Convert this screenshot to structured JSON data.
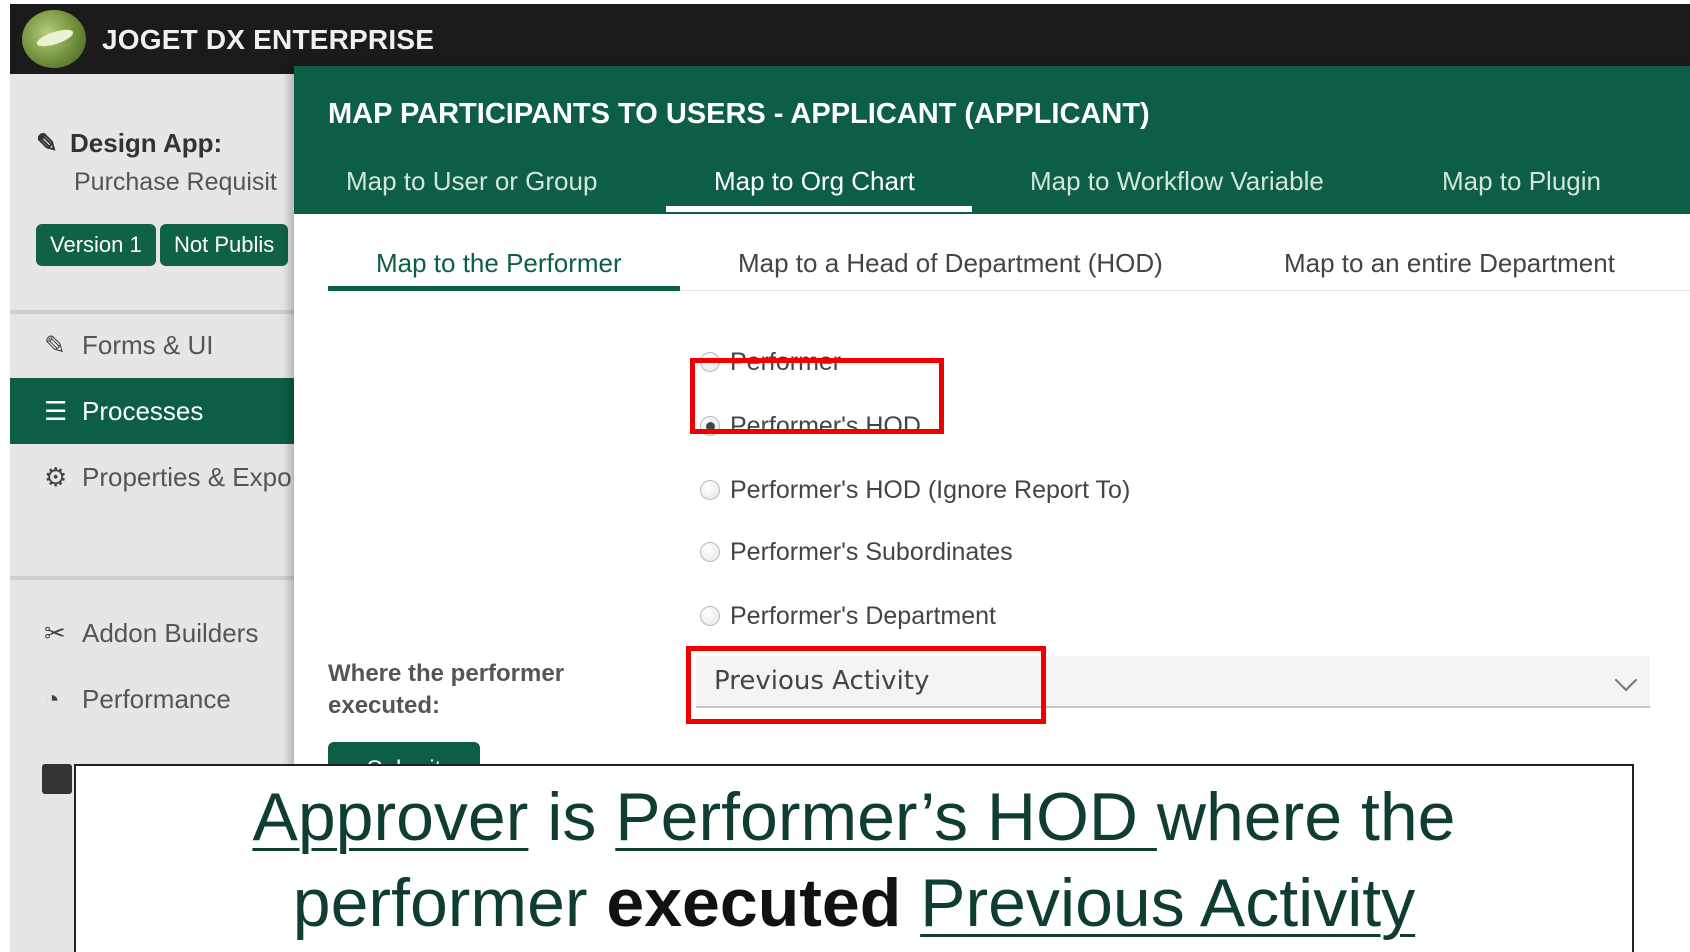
{
  "topbar": {
    "app_name": "JOGET DX ENTERPRISE"
  },
  "sidebar": {
    "design_label": "Design App:",
    "app_title": "Purchase Requisit",
    "badges": [
      "Version 1",
      "Not Publis"
    ],
    "items": [
      {
        "label": "Forms & UI",
        "icon": "edit-icon"
      },
      {
        "label": "Processes",
        "icon": "list-icon",
        "active": true
      },
      {
        "label": "Properties & Expo",
        "icon": "gear-icon"
      },
      {
        "label": "Addon Builders",
        "icon": "tools-icon"
      },
      {
        "label": "Performance",
        "icon": "gauge-icon"
      }
    ]
  },
  "modal": {
    "title": "MAP PARTICIPANTS TO USERS - APPLICANT (APPLICANT)",
    "tabs": [
      "Map to User or Group",
      "Map to Org Chart",
      "Map to Workflow Variable",
      "Map to Plugin"
    ],
    "active_tab": "Map to Org Chart",
    "subtabs": [
      "Map to the Performer",
      "Map to a Head of Department (HOD)",
      "Map to an entire Department"
    ],
    "active_subtab": "Map to the Performer",
    "options": [
      "Performer",
      "Performer's HOD",
      "Performer's HOD (Ignore Report To)",
      "Performer's Subordinates",
      "Performer's Department"
    ],
    "selected_option": "Performer's HOD",
    "field_label": "Where the performer executed:",
    "select_value": "Previous Activity",
    "submit_label": "Submit"
  },
  "caption": {
    "approver": "Approver",
    "is": " is ",
    "performers_hod": "Performer’s HOD ",
    "where_the": "where the",
    "performer": "performer ",
    "executed": "executed",
    "previous_activity": "Previous Activity"
  },
  "colors": {
    "brand_green": "#0d5e47",
    "highlight_red": "#ee0000",
    "topbar": "#1b1b1b"
  }
}
